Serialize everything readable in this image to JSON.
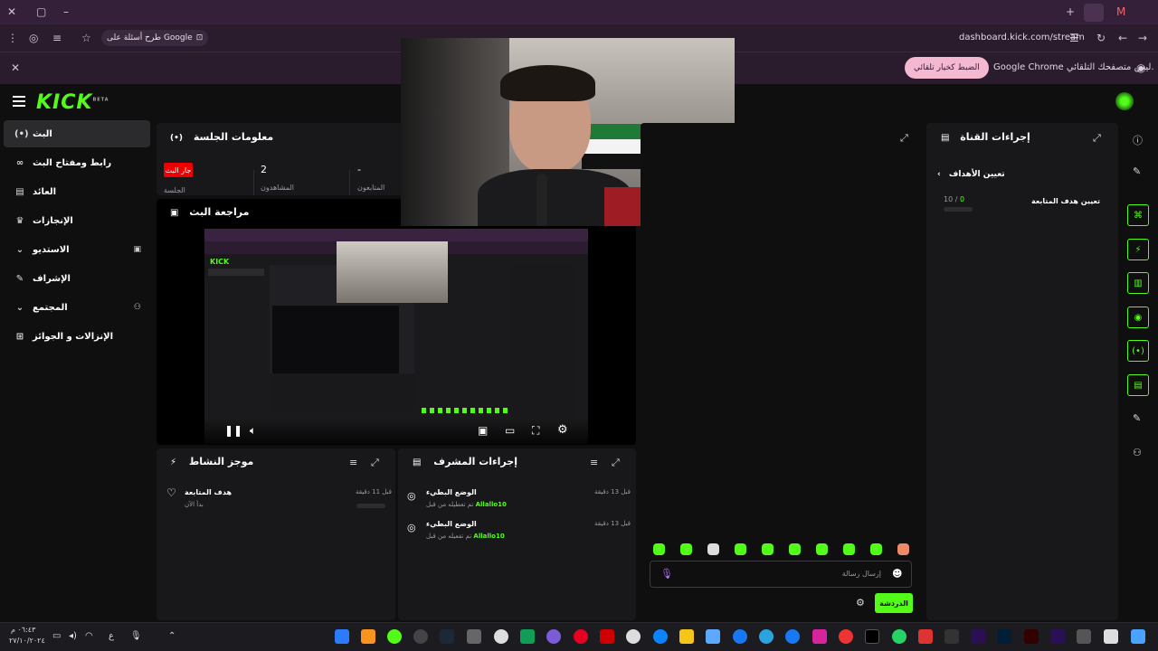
{
  "chrome": {
    "search_chip": "طرح أسئلة على Google",
    "url": "dashboard.kick.com/stream",
    "infobar_text": "Google Chrome ليس متصفحك التلقائي.",
    "infobar_button": "الضبط كخيار تلقائي"
  },
  "app": {
    "logo": "KICK",
    "logo_beta": "BETA"
  },
  "sidebar": {
    "items": [
      {
        "label": "البث",
        "icon": "broadcast-icon"
      },
      {
        "label": "رابط ومفتاح البث",
        "icon": "link-icon"
      },
      {
        "label": "العائد",
        "icon": "revenue-icon"
      },
      {
        "label": "الإنجازات",
        "icon": "trophy-icon"
      },
      {
        "label": "الاستديو",
        "icon": "studio-icon"
      },
      {
        "label": "الإشراف",
        "icon": "wrench-icon"
      },
      {
        "label": "المجتمع",
        "icon": "community-icon"
      },
      {
        "label": "الإنزالات و الجوائز",
        "icon": "drops-icon"
      }
    ]
  },
  "session": {
    "title": "معلومات الجلسة",
    "live_badge": "جار البث",
    "session_label": "الجلسة",
    "viewers_value": "2",
    "viewers_label": "المشاهدون",
    "followers_value": "-",
    "followers_label": "المتابعون"
  },
  "preview": {
    "title": "مراجعة البث"
  },
  "activity": {
    "title": "موجز النشاط",
    "item_title": "هدف المتابعة",
    "item_sub": "بدأ الآن",
    "item_time": "قبل 11 دقيقة"
  },
  "modactions": {
    "title": "إجراءات المشرف",
    "items": [
      {
        "title": "الوضع البطيء",
        "sub": "تم تعطيله من قبل",
        "user": "Allallo10",
        "time": "قبل 13 دقيقة"
      },
      {
        "title": "الوضع البطيء",
        "sub": "تم تفعيله من قبل",
        "user": "Allallo10",
        "time": "قبل 13 دقيقة"
      }
    ]
  },
  "channel_actions": {
    "title": "إجراءات القناة",
    "back_label": "تعيين الأهداف",
    "goal_label": "تعيين هدف المتابعة",
    "goal_current": "0",
    "goal_total": "10 /"
  },
  "chat": {
    "placeholder": "إرسال رسالة",
    "chat_button": "الدردشة"
  },
  "clock": {
    "time": "٠٦:٤٣ م",
    "date": "٢٧/١٠/٢٠٢٤",
    "lang": "ع"
  }
}
